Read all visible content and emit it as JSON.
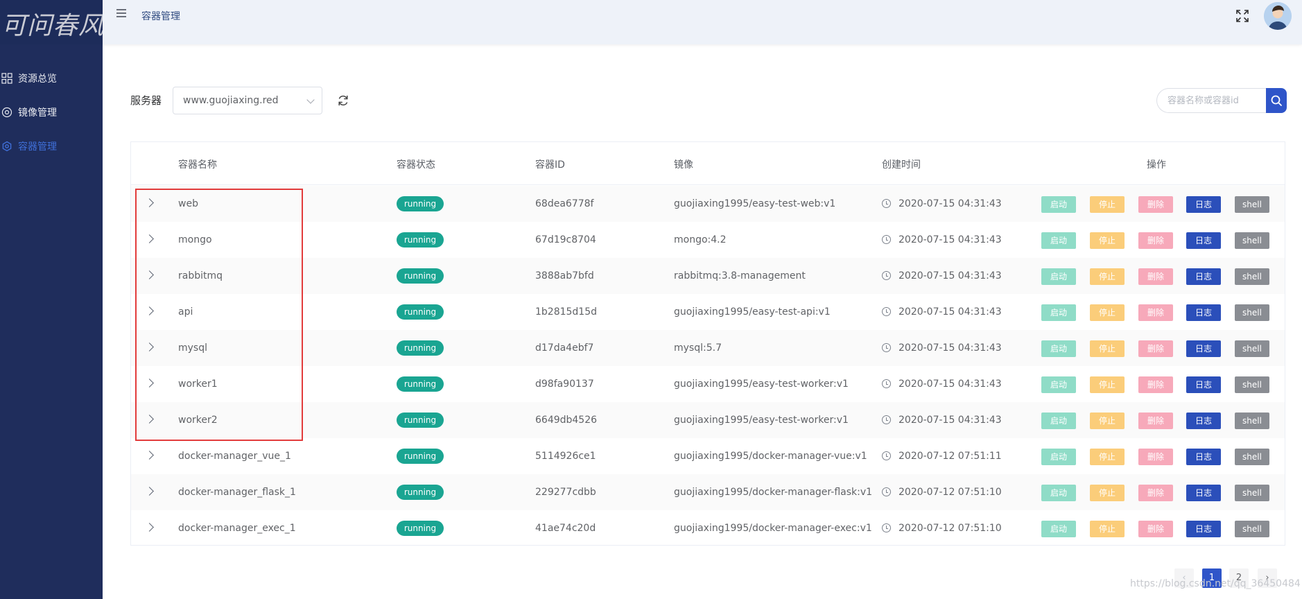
{
  "logo": {
    "text": "可问春风"
  },
  "sidebar": {
    "items": [
      {
        "label": "资源总览",
        "icon": "grid-icon",
        "active": false
      },
      {
        "label": "镜像管理",
        "icon": "disc-icon",
        "active": false
      },
      {
        "label": "容器管理",
        "icon": "gear-icon",
        "active": true
      }
    ]
  },
  "header": {
    "breadcrumb": "容器管理",
    "fullscreen_icon": "fullscreen-icon",
    "avatar_icon": "user-avatar"
  },
  "toolbar": {
    "server_label": "服务器",
    "server_selected": "www.guojiaxing.red",
    "search_placeholder": "容器名称或容器id"
  },
  "table": {
    "columns": [
      "容器名称",
      "容器状态",
      "容器ID",
      "镜像",
      "创建时间",
      "操作"
    ],
    "actions": {
      "start": "启动",
      "stop": "停止",
      "delete": "删除",
      "log": "日志",
      "shell": "shell"
    },
    "rows": [
      {
        "name": "web",
        "status": "running",
        "id": "68dea6778f",
        "image": "guojiaxing1995/easy-test-web:v1",
        "created": "2020-07-15 04:31:43"
      },
      {
        "name": "mongo",
        "status": "running",
        "id": "67d19c8704",
        "image": "mongo:4.2",
        "created": "2020-07-15 04:31:43"
      },
      {
        "name": "rabbitmq",
        "status": "running",
        "id": "3888ab7bfd",
        "image": "rabbitmq:3.8-management",
        "created": "2020-07-15 04:31:43"
      },
      {
        "name": "api",
        "status": "running",
        "id": "1b2815d15d",
        "image": "guojiaxing1995/easy-test-api:v1",
        "created": "2020-07-15 04:31:43"
      },
      {
        "name": "mysql",
        "status": "running",
        "id": "d17da4ebf7",
        "image": "mysql:5.7",
        "created": "2020-07-15 04:31:43"
      },
      {
        "name": "worker1",
        "status": "running",
        "id": "d98fa90137",
        "image": "guojiaxing1995/easy-test-worker:v1",
        "created": "2020-07-15 04:31:43"
      },
      {
        "name": "worker2",
        "status": "running",
        "id": "6649db4526",
        "image": "guojiaxing1995/easy-test-worker:v1",
        "created": "2020-07-15 04:31:43"
      },
      {
        "name": "docker-manager_vue_1",
        "status": "running",
        "id": "5114926ce1",
        "image": "guojiaxing1995/docker-manager-vue:v1",
        "created": "2020-07-12 07:51:11"
      },
      {
        "name": "docker-manager_flask_1",
        "status": "running",
        "id": "229277cdbb",
        "image": "guojiaxing1995/docker-manager-flask:v1",
        "created": "2020-07-12 07:51:10"
      },
      {
        "name": "docker-manager_exec_1",
        "status": "running",
        "id": "41ae74c20d",
        "image": "guojiaxing1995/docker-manager-exec:v1",
        "created": "2020-07-12 07:51:10"
      }
    ]
  },
  "pagination": {
    "prev": "‹",
    "pages": [
      "1",
      "2"
    ],
    "current": "1",
    "next": "›"
  },
  "watermark": "https://blog.csdn.net/qq_36450484",
  "colors": {
    "sidebar": "#1f2d5c",
    "accent": "#2f55c9",
    "running": "#1aa592",
    "highlight": "#e23b3b"
  }
}
